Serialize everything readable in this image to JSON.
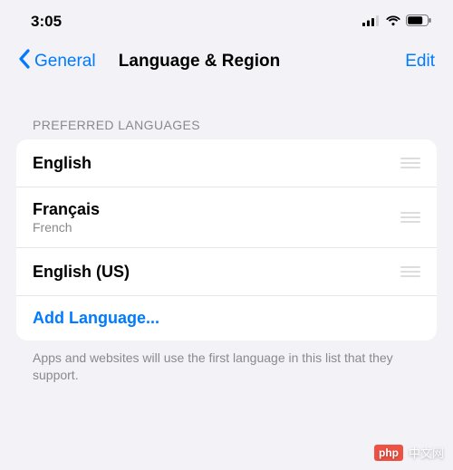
{
  "status": {
    "time": "3:05"
  },
  "nav": {
    "back_label": "General",
    "title": "Language & Region",
    "edit_label": "Edit"
  },
  "section": {
    "header": "PREFERRED LANGUAGES"
  },
  "languages": [
    {
      "title": "English",
      "sub": ""
    },
    {
      "title": "Français",
      "sub": "French"
    },
    {
      "title": "English (US)",
      "sub": ""
    }
  ],
  "add_language_label": "Add Language...",
  "footer": "Apps and websites will use the first language in this list that they support.",
  "watermark": {
    "logo": "php",
    "text": "中文网"
  }
}
